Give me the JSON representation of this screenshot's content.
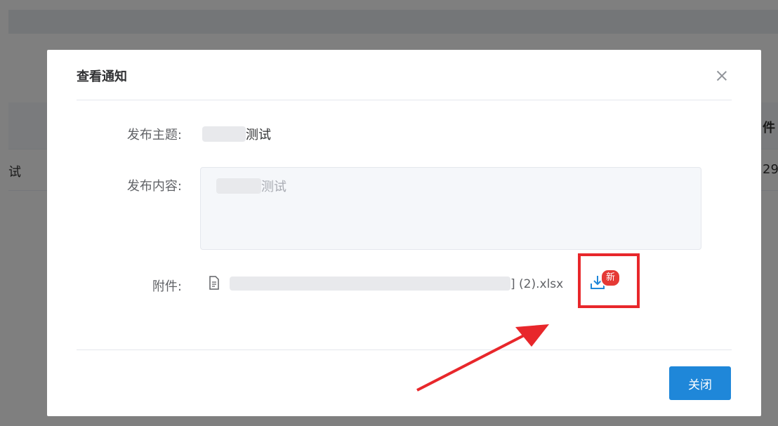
{
  "background": {
    "left_cell_fragment": "试",
    "right_header_fragment": "件",
    "right_cell_fragment": "29"
  },
  "dialog": {
    "title": "查看通知",
    "subject_label": "发布主题:",
    "subject_value_suffix": "测试",
    "content_label": "发布内容:",
    "content_value_suffix": "测试",
    "attachment_label": "附件:",
    "attachment_filename_suffix": "] (2).xlsx",
    "new_badge": "新",
    "close_button": "关闭"
  },
  "icons": {
    "close": "close-icon",
    "file": "document-icon",
    "download": "download-icon"
  },
  "colors": {
    "primary_button": "#1f87d9",
    "badge": "#e53935",
    "annotation": "#e8272b"
  }
}
